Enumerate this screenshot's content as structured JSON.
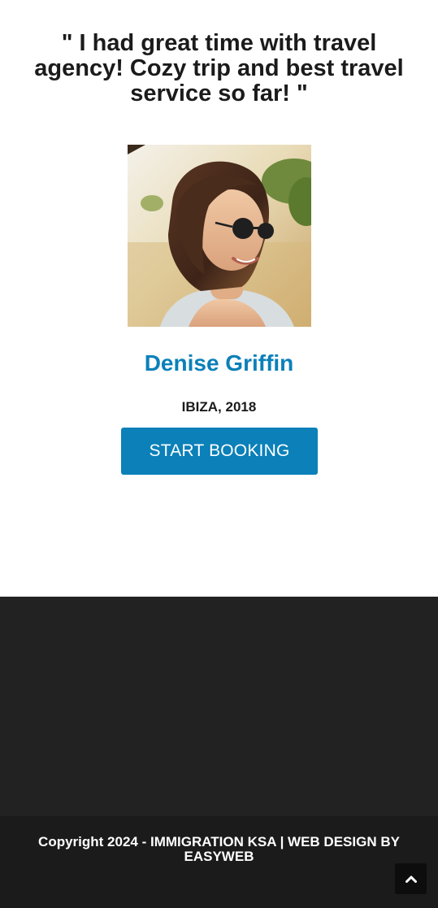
{
  "testimonial": {
    "quote": "\" I had great time with travel agency! Cozy trip and best travel service so far! \"",
    "photo_icon": "woman-portrait-photo",
    "name": "Denise Griffin",
    "location": "IBIZA, 2018",
    "cta_label": "START BOOKING"
  },
  "footer": {
    "copyright": "Copyright 2024 - IMMIGRATION KSA | WEB DESIGN BY EASYWEB",
    "scroll_top_icon": "chevron-up-icon"
  },
  "colors": {
    "accent": "#0b80b9",
    "text_dark": "#1b1b1b",
    "footer_widgets_bg": "#222222",
    "footer_bottom_bg": "#1b1b1b"
  }
}
